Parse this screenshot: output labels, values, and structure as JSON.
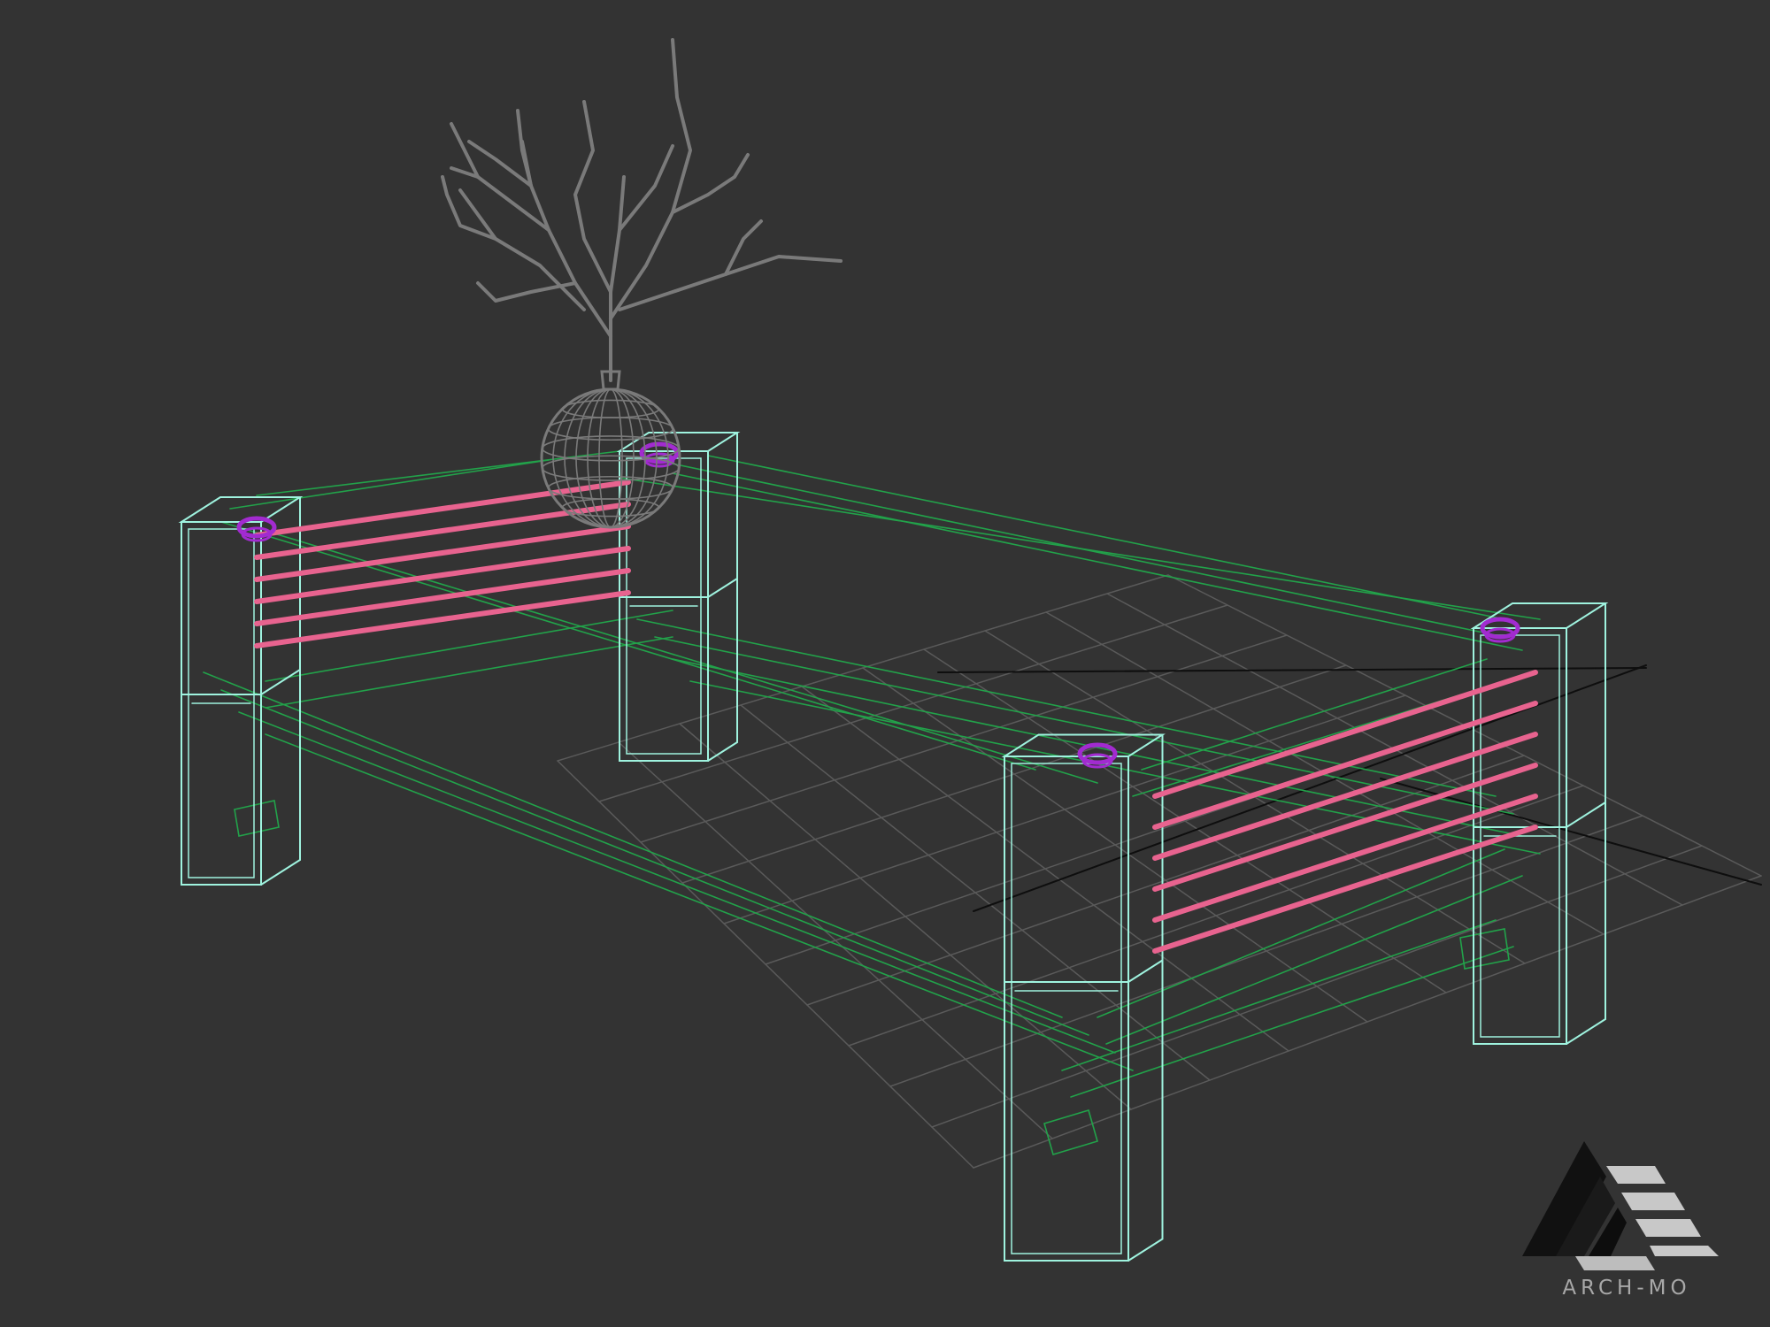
{
  "viewport": {
    "background": "#333333",
    "colors": {
      "grid": "#5a5a5a",
      "axis": "#0e0e0e",
      "frame": "#9ff3df",
      "bracing": "#22a24a",
      "slats": "#e8638f",
      "caps": "#a22bd0",
      "vase": "#7a7a7a"
    }
  },
  "scene_objects": [
    "grid-floor",
    "bench-frame",
    "side-slats",
    "leg-caps",
    "vase",
    "branches"
  ],
  "brand": {
    "logo_icon": "arch-mo-logo-icon",
    "name": "ARCH-MO"
  }
}
